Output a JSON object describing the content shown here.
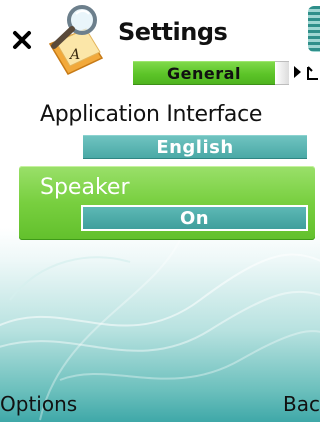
{
  "header": {
    "title": "Settings",
    "close_icon": "close-icon",
    "app_icon": "settings-app-icon"
  },
  "tabs": {
    "active_label": "General",
    "next_arrow_icon": "chevron-right-icon"
  },
  "settings": [
    {
      "label": "Application Interface",
      "value": "English",
      "selected": false
    },
    {
      "label": "Speaker",
      "value": "On",
      "selected": true
    }
  ],
  "softkeys": {
    "left": "Options",
    "right": "Bacl"
  },
  "colors": {
    "highlight_green": "#78cf3f",
    "tab_green": "#5cc428",
    "value_teal": "#4aa9a6",
    "background_teal": "#3fa8a8"
  }
}
